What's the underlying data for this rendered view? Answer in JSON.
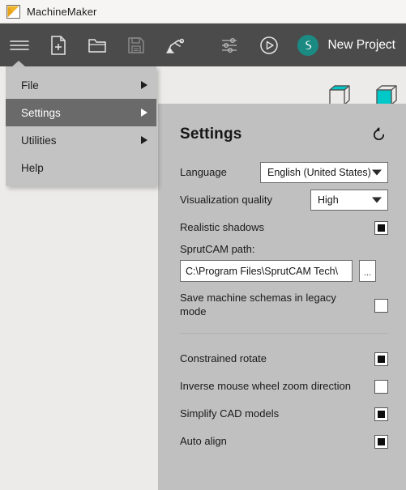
{
  "titlebar": {
    "app_name": "MachineMaker",
    "logo_icon": "machinemaker-logo"
  },
  "toolbar": {
    "project_name": "New Project",
    "buttons": [
      {
        "name": "menu-button",
        "icon": "hamburger-icon"
      },
      {
        "name": "new-file-button",
        "icon": "new-document-icon"
      },
      {
        "name": "open-file-button",
        "icon": "folder-open-icon"
      },
      {
        "name": "save-button",
        "icon": "floppy-disk-icon"
      },
      {
        "name": "robot-button",
        "icon": "robot-arm-icon"
      },
      {
        "name": "parameters-button",
        "icon": "sliders-icon"
      },
      {
        "name": "run-button",
        "icon": "play-circle-icon"
      },
      {
        "name": "sprutcam-button",
        "icon": "sprutcam-logo-icon"
      }
    ]
  },
  "menu": {
    "items": [
      {
        "label": "File",
        "has_submenu": true,
        "active": false
      },
      {
        "label": "Settings",
        "has_submenu": true,
        "active": true
      },
      {
        "label": "Utilities",
        "has_submenu": true,
        "active": false
      },
      {
        "label": "Help",
        "has_submenu": false,
        "active": false
      }
    ]
  },
  "viewport_icons": [
    {
      "name": "cube-wireframe-top-icon"
    },
    {
      "name": "cube-filled-icon"
    }
  ],
  "settings": {
    "title": "Settings",
    "reset_icon": "reset-arrow-icon",
    "language": {
      "label": "Language",
      "value": "English (United States)",
      "options": [
        "English (United States)"
      ]
    },
    "visualization_quality": {
      "label": "Visualization quality",
      "value": "High",
      "options": [
        "High"
      ]
    },
    "realistic_shadows": {
      "label": "Realistic shadows",
      "checked": true
    },
    "sprutcam_path": {
      "label": "SprutCAM path:",
      "value": "C:\\Program Files\\SprutCAM Tech\\",
      "browse_label": "..."
    },
    "legacy_schemas": {
      "label": "Save machine schemas in legacy mode",
      "checked": false
    },
    "constrained_rotate": {
      "label": "Constrained rotate",
      "checked": true
    },
    "inverse_zoom": {
      "label": "Inverse mouse wheel zoom direction",
      "checked": false
    },
    "simplify_cad": {
      "label": "Simplify CAD models",
      "checked": true
    },
    "auto_align": {
      "label": "Auto align",
      "checked": true
    }
  },
  "colors": {
    "toolbar_bg": "#4b4b4b",
    "panel_bg": "#c0c0c0",
    "menu_bg": "#c3c3c3",
    "menu_active_bg": "#6a6a6a",
    "accent_teal": "#00c8c8",
    "logo_yellow": "#f0b429",
    "app_bg": "#ecebe9"
  }
}
